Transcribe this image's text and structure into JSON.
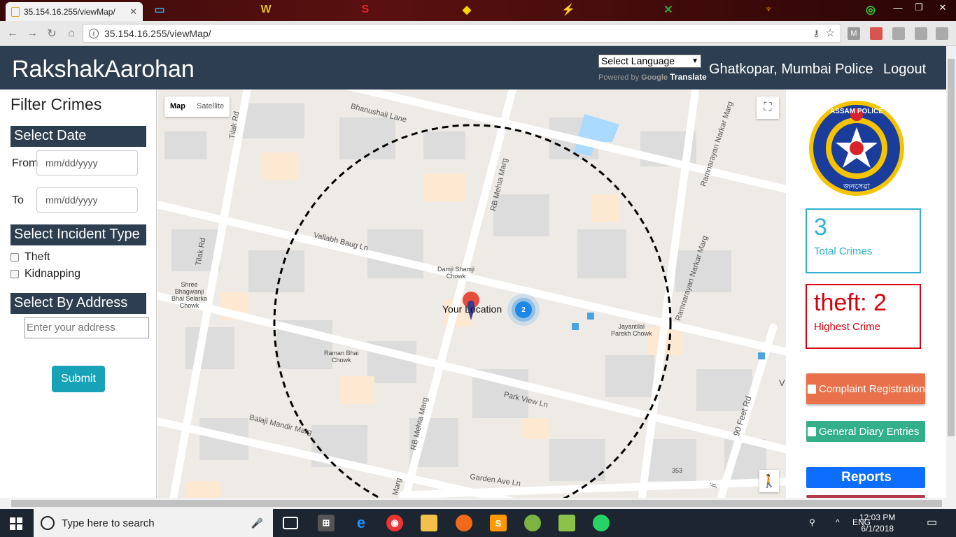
{
  "browser": {
    "tab_title": "35.154.16.255/viewMap/",
    "tab_close": "✕",
    "url": "35.154.16.255/viewMap/",
    "info_glyph": "i",
    "key_glyph": "⚷",
    "star_glyph": "☆",
    "back_glyph": "←",
    "forward_glyph": "→",
    "reload_glyph": "↻",
    "home_glyph": "⌂",
    "win_minimize": "—",
    "win_maximize": "❐",
    "win_close": "✕"
  },
  "header": {
    "brand": "RakshakAarohan",
    "language_select": "Select Language",
    "powered_by": "Powered by",
    "google": "Google",
    "translate": "Translate",
    "station": "Ghatkopar, Mumbai Police",
    "logout": "Logout"
  },
  "filter": {
    "title": "Filter Crimes",
    "select_date": "Select Date",
    "from_label": "From",
    "to_label": "To",
    "date_placeholder": "mm/dd/yyyy",
    "select_incident": "Select Incident Type",
    "incident_types": [
      "Theft",
      "Kidnapping"
    ],
    "select_address": "Select By Address",
    "address_placeholder": "Enter your address",
    "submit": "Submit"
  },
  "map": {
    "type_map": "Map",
    "type_satellite": "Satellite",
    "fullscreen_glyph": "⛶",
    "pegman_glyph": "🚶",
    "your_location": "Your Location",
    "cluster_count": "2",
    "streets": {
      "bhanushali": "Bhanushali Lane",
      "tilak_top": "Tilak Rd",
      "tilak_left": "Tilak Rd",
      "rb_mehta_top": "RB Mehta Marg",
      "rb_mehta_bottom": "RB Mehta Marg",
      "ramnarayan_1": "Ramnarayan Narkar Marg",
      "ramnarayan_2": "Ramnarayan Narkar Marg",
      "vallabh": "Vallabh Baug Ln",
      "park_view": "Park View Ln",
      "balaji": "Balaji Mandir Marg",
      "garden": "Garden Ave Ln",
      "feet_90": "90 Feet Rd",
      "marg_bottom": "Marg",
      "v_edge": "V",
      "ji_edge": "ji"
    },
    "pois": {
      "damji": "Damji Shamji\nChowk",
      "shree": "Shree\nBhagwanji\nBhai Selarka\nChowk",
      "jayantilal": "Jayantilal\nParekh Chowk",
      "raman": "Raman Bhai\nChowk",
      "num_353": "353"
    }
  },
  "stats": {
    "total_value": "3",
    "total_label": "Total Crimes",
    "highest_value": "theft: 2",
    "highest_label": "Highest Crime"
  },
  "actions": {
    "complaint": "Complaint Registration",
    "diary": "General Diary Entries",
    "reports": "Reports"
  },
  "emblem": {
    "text_top": "ASSAM POLICE",
    "text_bottom": "জনসেৱা"
  },
  "taskbar": {
    "search_placeholder": "Type here to search",
    "lang": "ENG",
    "time": "12:03 PM",
    "date": "6/1/2018"
  },
  "colors": {
    "header_bg": "#2c3e50",
    "submit_bg": "#17a2b8",
    "total_border": "#31b0d5",
    "highest_border": "#d9000d",
    "complaint_bg": "#e8704a",
    "diary_bg": "#33b08a",
    "reports_bg": "#0d6efd"
  }
}
